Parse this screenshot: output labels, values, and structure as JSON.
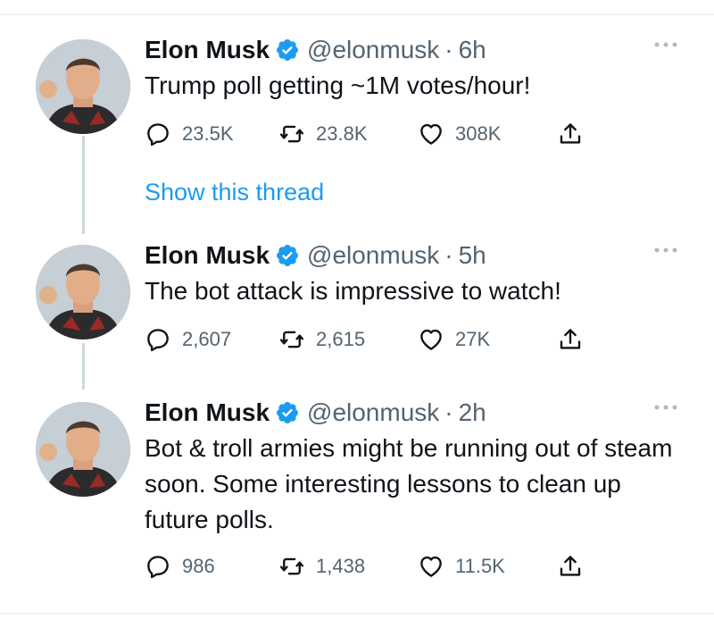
{
  "tweets": [
    {
      "name": "Elon Musk",
      "handle": "@elonmusk",
      "separator": "·",
      "time": "6h",
      "text": "Trump poll getting ~1M votes/hour!",
      "replies": "23.5K",
      "retweets": "23.8K",
      "likes": "308K"
    },
    {
      "name": "Elon Musk",
      "handle": "@elonmusk",
      "separator": "·",
      "time": "5h",
      "text": "The bot attack is impressive to watch!",
      "replies": "2,607",
      "retweets": "2,615",
      "likes": "27K"
    },
    {
      "name": "Elon Musk",
      "handle": "@elonmusk",
      "separator": "·",
      "time": "2h",
      "text": "Bot & troll armies might be running out of steam soon. Some interesting lessons to clean up future polls.",
      "replies": "986",
      "retweets": "1,438",
      "likes": "11.5K"
    }
  ],
  "show_thread": "Show this thread",
  "colors": {
    "accent": "#1d9bf0",
    "secondary_text": "#536471",
    "primary_text": "#0f1419"
  },
  "icons": [
    "verified-badge-icon",
    "more-icon",
    "reply-icon",
    "retweet-icon",
    "like-icon",
    "share-icon"
  ]
}
